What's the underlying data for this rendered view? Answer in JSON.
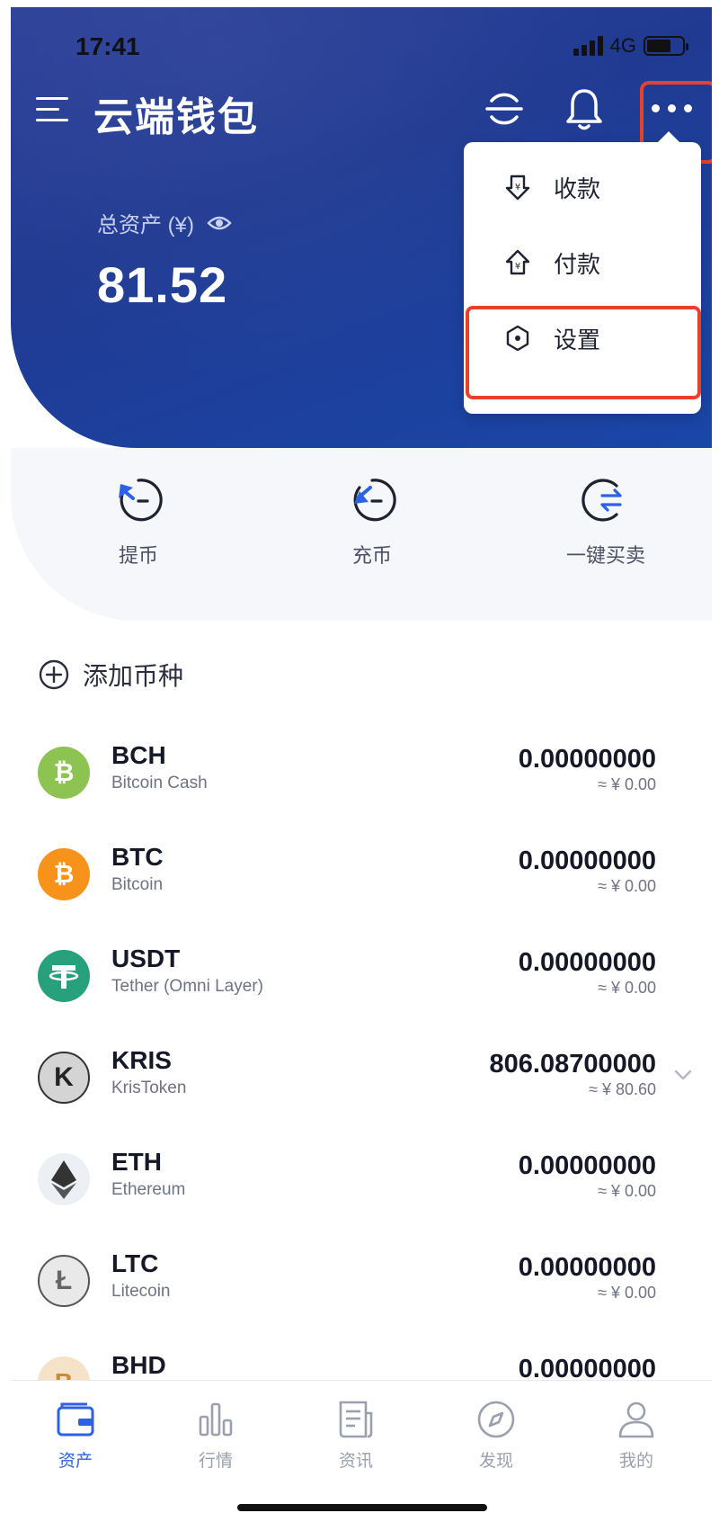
{
  "status_bar": {
    "time": "17:41",
    "network": "4G"
  },
  "header": {
    "title": "云端钱包"
  },
  "total": {
    "label": "总资产 (¥)",
    "value": "81.52"
  },
  "dropdown": {
    "items": [
      {
        "label": "收款",
        "icon": "receive-icon"
      },
      {
        "label": "付款",
        "icon": "pay-icon"
      },
      {
        "label": "设置",
        "icon": "settings-icon"
      }
    ]
  },
  "actions": [
    {
      "label": "提币",
      "icon": "withdraw-icon"
    },
    {
      "label": "充币",
      "icon": "deposit-icon"
    },
    {
      "label": "一键买卖",
      "icon": "trade-icon"
    }
  ],
  "add_coin": {
    "label": "添加币种"
  },
  "coins": [
    {
      "symbol": "BCH",
      "name": "Bitcoin Cash",
      "balance": "0.00000000",
      "fiat": "≈ ¥ 0.00",
      "color": "#8dc351"
    },
    {
      "symbol": "BTC",
      "name": "Bitcoin",
      "balance": "0.00000000",
      "fiat": "≈ ¥ 0.00",
      "color": "#f7931a"
    },
    {
      "symbol": "USDT",
      "name": "Tether (Omni Layer)",
      "balance": "0.00000000",
      "fiat": "≈ ¥ 0.00",
      "color": "#26a17b"
    },
    {
      "symbol": "KRIS",
      "name": "KrisToken",
      "balance": "806.08700000",
      "fiat": "≈ ¥ 80.60",
      "color": "#cfcfcf"
    },
    {
      "symbol": "ETH",
      "name": "Ethereum",
      "balance": "0.00000000",
      "fiat": "≈ ¥ 0.00",
      "color": "#eceff3"
    },
    {
      "symbol": "LTC",
      "name": "Litecoin",
      "balance": "0.00000000",
      "fiat": "≈ ¥ 0.00",
      "color": "#e9e9e9"
    },
    {
      "symbol": "BHD",
      "name": "",
      "balance": "0.00000000",
      "fiat": "",
      "color": "#f6e2c8"
    }
  ],
  "bottom_nav": [
    {
      "label": "资产",
      "icon": "wallet-icon",
      "active": true
    },
    {
      "label": "行情",
      "icon": "chart-bars-icon",
      "active": false
    },
    {
      "label": "资讯",
      "icon": "news-icon",
      "active": false
    },
    {
      "label": "发现",
      "icon": "compass-icon",
      "active": false
    },
    {
      "label": "我的",
      "icon": "user-icon",
      "active": false
    }
  ],
  "colors": {
    "primary": "#2b3f98",
    "accent": "#2d62e6",
    "highlight": "#e8402f"
  }
}
